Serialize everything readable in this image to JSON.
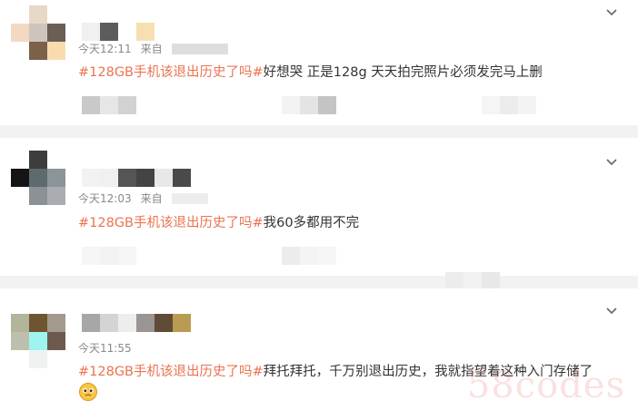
{
  "posts": [
    {
      "time": "今天12:11",
      "source_label": "来自",
      "topic": "#128GB手机该退出历史了吗#",
      "body": "好想哭 正是128g 天天拍完照片必须发完马上删"
    },
    {
      "time": "今天12:03",
      "source_label": "来自",
      "topic": "#128GB手机该退出历史了吗#",
      "body": "我60多都用不完"
    },
    {
      "time": "今天11:55",
      "source_label": "",
      "topic": "#128GB手机该退出历史了吗#",
      "body": "拜托拜托，千万别退出历史，我就指望着这种入门存储了"
    }
  ],
  "icons": {
    "menu": "chevron-down-icon",
    "emoji": "pleading-face-emoji-icon"
  },
  "colors": {
    "topic": "#eb7350",
    "text": "#333333",
    "meta": "#888888",
    "separator": "#f2f2f2"
  },
  "watermark": "58codes"
}
